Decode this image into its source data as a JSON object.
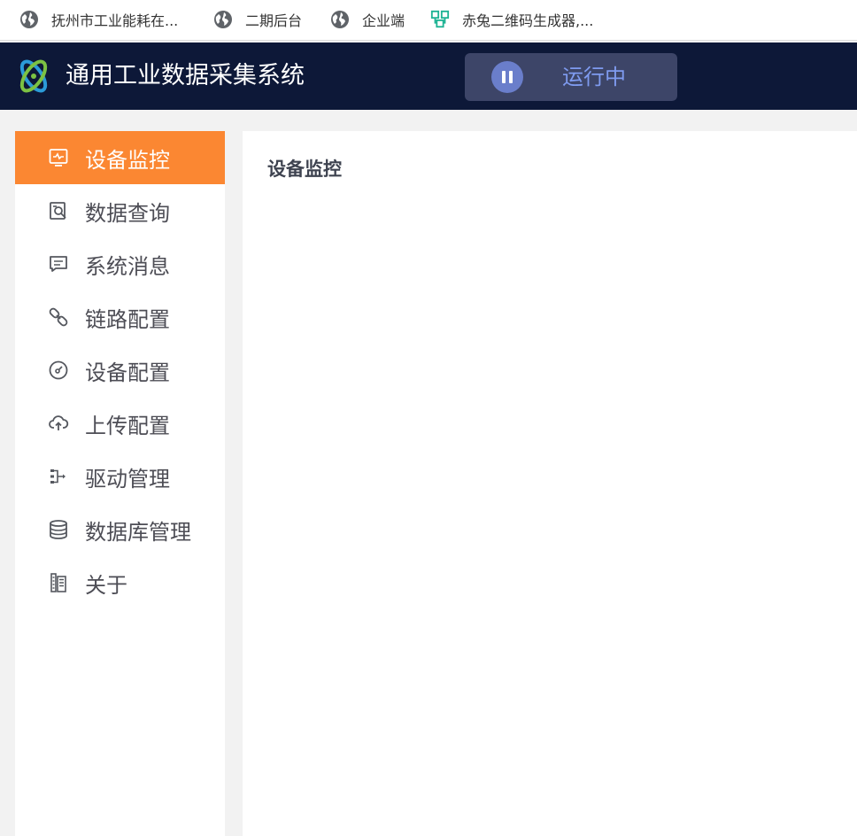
{
  "bookmarks": [
    {
      "label": "抚州市工业能耗在...",
      "icon": "globe-icon"
    },
    {
      "label": "二期后台",
      "icon": "globe-icon"
    },
    {
      "label": "企业端",
      "icon": "globe-icon"
    },
    {
      "label": "赤兔二维码生成器,...",
      "icon": "qrcode-icon"
    }
  ],
  "header": {
    "title": "通用工业数据采集系统",
    "status": "运行中",
    "status_icon": "pause-icon"
  },
  "sidebar": {
    "items": [
      {
        "label": "设备监控",
        "icon": "monitor-icon",
        "active": true
      },
      {
        "label": "数据查询",
        "icon": "search-doc-icon"
      },
      {
        "label": "系统消息",
        "icon": "message-icon"
      },
      {
        "label": "链路配置",
        "icon": "link-icon"
      },
      {
        "label": "设备配置",
        "icon": "gauge-icon"
      },
      {
        "label": "上传配置",
        "icon": "cloud-upload-icon"
      },
      {
        "label": "驱动管理",
        "icon": "driver-icon"
      },
      {
        "label": "数据库管理",
        "icon": "database-icon"
      },
      {
        "label": "关于",
        "icon": "building-icon"
      }
    ]
  },
  "content": {
    "title": "设备监控"
  },
  "colors": {
    "header_bg": "#0d1838",
    "active_nav": "#fb8732",
    "status_text": "#7f9bf0",
    "page_bg": "#f2f2f2"
  }
}
